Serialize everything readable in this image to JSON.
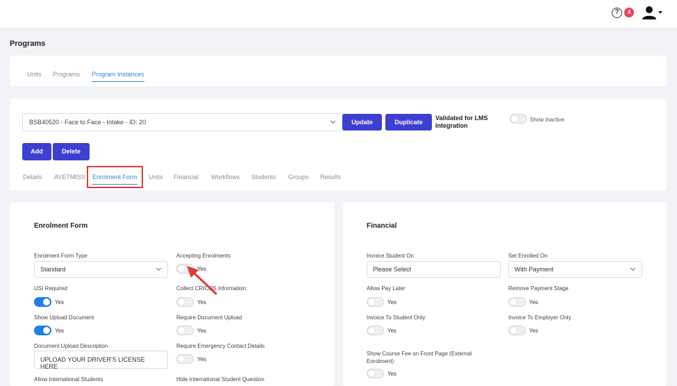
{
  "header": {
    "notification_count": "4",
    "help_glyph": "?"
  },
  "page_title": "Programs",
  "top_tabs": [
    "Units",
    "Programs",
    "Program Instances"
  ],
  "instance_select": {
    "value": "BSB40520 - Face to Face - Intake - ID: 20"
  },
  "buttons": {
    "update": "Update",
    "duplicate": "Duplicate",
    "add": "Add",
    "delete": "Delete"
  },
  "validated_text": "Validated for LMS Integration",
  "show_inactive": "Show Inactive",
  "sub_tabs": [
    "Details",
    "AVETMISS",
    "Enrolment Form",
    "Units",
    "Financial",
    "Workflows",
    "Students",
    "Groups",
    "Results"
  ],
  "enrolment_form": {
    "title": "Enrolment Form",
    "form_type_label": "Enrolment Form Type",
    "form_type_value": "Standard",
    "accepting_label": "Accepting Enrolments",
    "usi_label": "USI Required",
    "cricos_label": "Collect CRICOS Information:",
    "show_upload_label": "Show Upload Document",
    "require_upload_label": "Require Document Upload",
    "upload_desc_label": "Document Upload Description",
    "upload_desc_value": "UPLOAD YOUR DRIVER'S LICENSE HERE",
    "emergency_label": "Require Emergency Contact Details",
    "intl_label": "Allow International Students",
    "hide_intl_label": "Hide International Student Question"
  },
  "financial": {
    "title": "Financial",
    "invoice_on_label": "Invoice Student On",
    "invoice_on_value": "Please Select",
    "set_enrolled_label": "Set Enrolled On",
    "set_enrolled_value": "With Payment",
    "pay_later_label": "Allow Pay Later",
    "remove_payment_label": "Remove Payment Stage",
    "invoice_student_only_label": "Invoice To Student Only",
    "invoice_employer_only_label": "Invoice To Employer Only",
    "course_fee_label": "Show Course Fee on Front Page (External Enrolment)"
  },
  "yes_label": "Yes",
  "colors": {
    "accent": "#3c3fd0",
    "tab_active": "#3a86c8",
    "toggle_on": "#1f7ee8",
    "annotation": "#e03a3a"
  }
}
